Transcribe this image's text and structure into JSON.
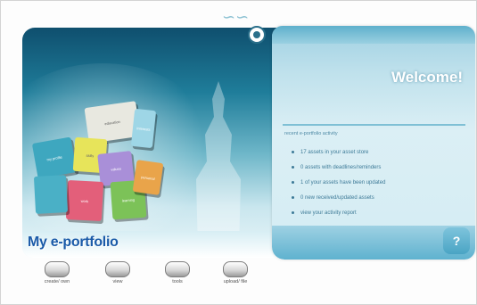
{
  "app": {
    "title": "My e-portfolio"
  },
  "welcome": {
    "title": "Welcome!",
    "heading": "recent e-portfolio activity",
    "items": [
      "17 assets in your asset store",
      "0 assets with deadlines/reminders",
      "1 of your assets have been updated",
      "0 new received/updated assets",
      "view your activity report"
    ],
    "help_label": "?"
  },
  "toolbar": {
    "buttons": [
      {
        "label": "create/ own"
      },
      {
        "label": "view"
      },
      {
        "label": "tools"
      },
      {
        "label": "upload/ file"
      }
    ]
  },
  "puzzle": {
    "pieces": [
      "education",
      "interests",
      "my profile",
      "skills",
      "values",
      "work",
      "learning",
      "personal"
    ]
  },
  "colors": {
    "title_blue": "#1a5aa8",
    "panel_blue": "#bfe1ec",
    "hero_dark": "#0f4f6e"
  }
}
